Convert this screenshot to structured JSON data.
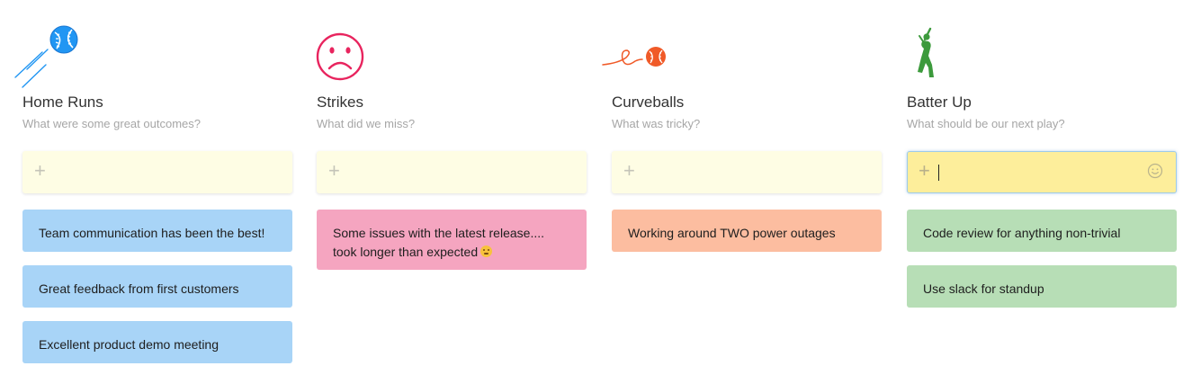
{
  "colors": {
    "note_blue": "#a8d4f7",
    "note_pink": "#f5a5c0",
    "note_orange": "#fcbda0",
    "note_green": "#b7deb6",
    "add_box": "#fefde4",
    "add_box_active": "#fdee9b"
  },
  "columns": [
    {
      "icon": "baseball-home-run-icon",
      "title": "Home Runs",
      "subtitle": "What were some great outcomes?",
      "add_placeholder": "+",
      "notes": [
        "Team communication has been the best!",
        "Great feedback from first customers",
        "Excellent product demo meeting"
      ]
    },
    {
      "icon": "sad-face-icon",
      "title": "Strikes",
      "subtitle": "What did we miss?",
      "add_placeholder": "+",
      "notes": [
        "Some issues with the latest release.... took longer than expected"
      ]
    },
    {
      "icon": "curveball-icon",
      "title": "Curveballs",
      "subtitle": "What was tricky?",
      "add_placeholder": "+",
      "notes": [
        "Working around TWO power outages"
      ]
    },
    {
      "icon": "batter-icon",
      "title": "Batter Up",
      "subtitle": "What should be our next play?",
      "add_placeholder": "+",
      "add_active": true,
      "add_value": "",
      "notes": [
        "Code review for anything non-trivial",
        "Use slack for standup"
      ]
    }
  ]
}
